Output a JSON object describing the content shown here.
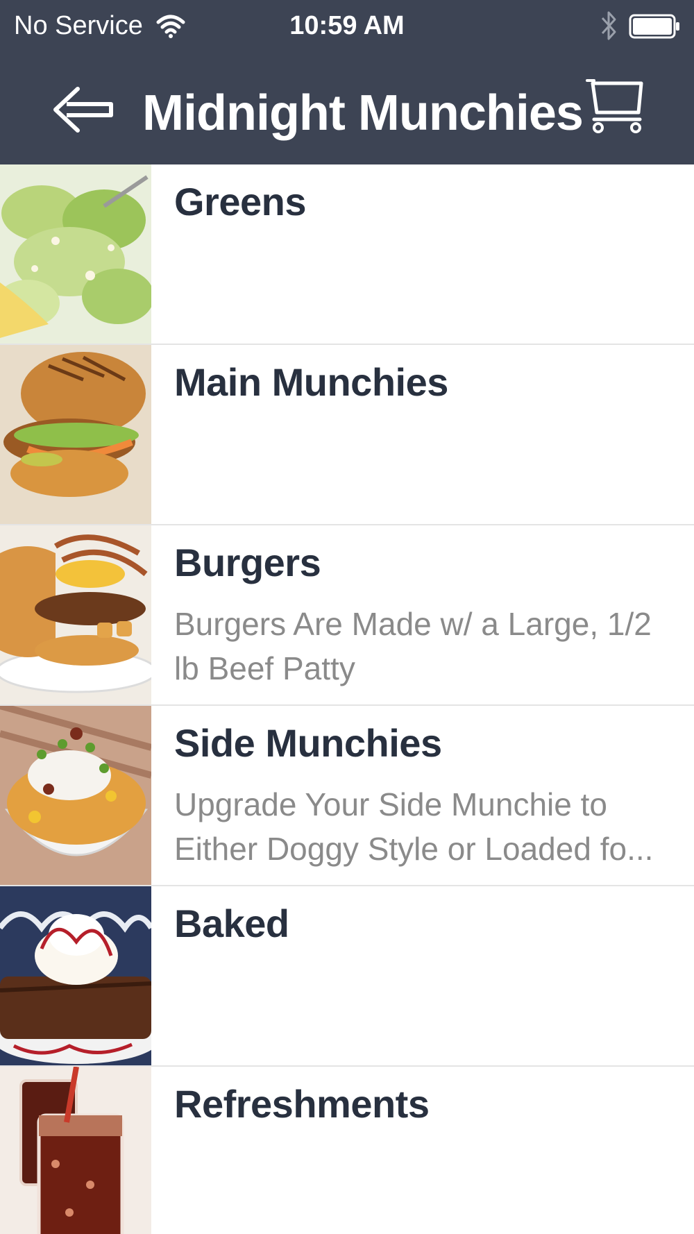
{
  "status_bar": {
    "carrier": "No Service",
    "time": "10:59 AM"
  },
  "nav": {
    "title": "Midnight Munchies",
    "back_icon": "arrow-left-icon",
    "cart_icon": "cart-icon"
  },
  "categories": [
    {
      "name": "Greens",
      "description": ""
    },
    {
      "name": "Main Munchies",
      "description": ""
    },
    {
      "name": "Burgers",
      "description": "Burgers Are Made w/ a Large, 1/2 lb Beef Patty"
    },
    {
      "name": "Side Munchies",
      "description": "Upgrade Your Side Munchie to Either Doggy Style or Loaded fo..."
    },
    {
      "name": "Baked",
      "description": ""
    },
    {
      "name": "Refreshments",
      "description": ""
    }
  ],
  "colors": {
    "header_bg": "#3d4454",
    "title_text": "#28303f",
    "description_text": "#8a8a8a"
  }
}
